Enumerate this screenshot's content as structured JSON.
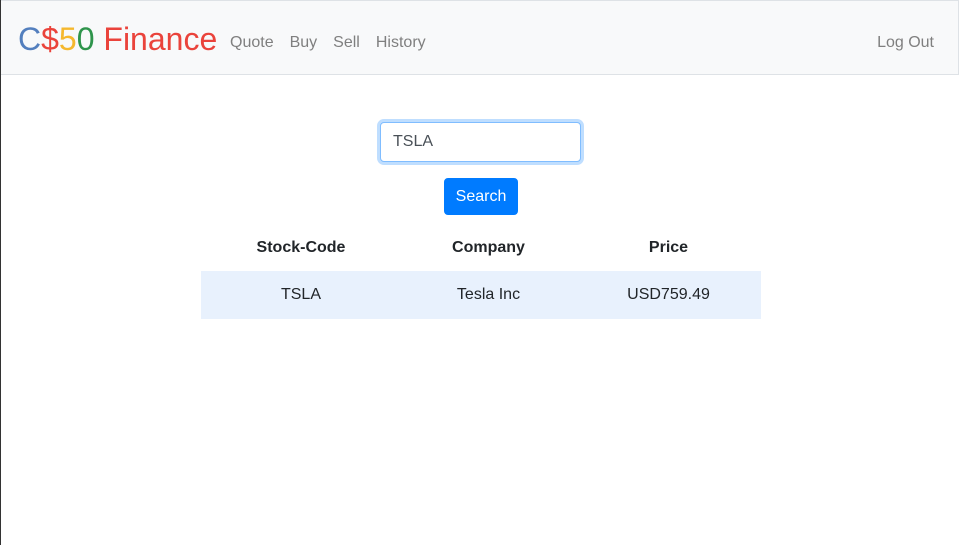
{
  "brand": {
    "part1": "C",
    "part2": "$",
    "part3": "5",
    "part4": "0",
    "part5": " Finance"
  },
  "nav": {
    "links": [
      "Quote",
      "Buy",
      "Sell",
      "History"
    ],
    "logout": "Log Out"
  },
  "search": {
    "value": "TSLA",
    "button_label": "Search"
  },
  "table": {
    "headers": [
      "Stock-Code",
      "Company",
      "Price"
    ],
    "rows": [
      [
        "TSLA",
        "Tesla Inc",
        "USD759.49"
      ]
    ]
  },
  "colors": {
    "brand_blue": "#537fbe",
    "brand_red": "#ea433b",
    "brand_yellow": "#f5b82e",
    "brand_green": "#2e944b",
    "primary": "#007bff",
    "row_highlight": "#e8f1fd"
  }
}
